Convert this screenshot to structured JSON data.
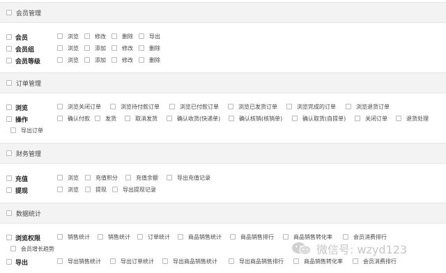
{
  "sections": [
    {
      "title": "会员管理",
      "rows": [
        {
          "label": "会员",
          "options": [
            "浏览",
            "修改",
            "删除",
            "导出"
          ]
        },
        {
          "label": "会员组",
          "options": [
            "浏览",
            "添加",
            "修改",
            "删除"
          ]
        },
        {
          "label": "会员等级",
          "options": [
            "浏览",
            "添加",
            "修改",
            "删除"
          ]
        }
      ]
    },
    {
      "title": "订单管理",
      "rows": [
        {
          "label": "浏览",
          "options": [
            "浏览关闭订单",
            "浏览待付款订单",
            "浏览已付款订单",
            "浏览已发货订单",
            "浏览完成的订单",
            "浏览退货订单"
          ]
        },
        {
          "label": "操作",
          "options": [
            "确认付款",
            "发货",
            "取消发货",
            "确认收货(快递单)",
            "确认核销(核销单)",
            "确认取货(自提单)",
            "关闭订单",
            "退货处理"
          ],
          "wrap_options": [
            "导出订单"
          ]
        }
      ]
    },
    {
      "title": "财务管理",
      "rows": [
        {
          "label": "充值",
          "options": [
            "浏览",
            "充值积分",
            "充值余额",
            "导出充值记录"
          ]
        },
        {
          "label": "提现",
          "options": [
            "浏览",
            "提现",
            "导出提现记录"
          ]
        }
      ]
    },
    {
      "title": "数据统计",
      "rows": [
        {
          "label": "浏览权限",
          "options": [
            "销售统计",
            "销售统计",
            "订单统计",
            "商品销售统计",
            "商品销售排行",
            "商品销售转化率",
            "会员消费排行"
          ],
          "wrap_options": [
            "会员增长趋势"
          ]
        },
        {
          "label": "导出",
          "options": [
            "导出销售统计",
            "导出订单统计",
            "导出商品销售统计",
            "导出商品销售排行",
            "商品销售转化率",
            "会员消费排行"
          ]
        }
      ]
    }
  ],
  "watermark": {
    "text": "微信号: wzyd123",
    "icon": "wechat-logo-icon"
  }
}
